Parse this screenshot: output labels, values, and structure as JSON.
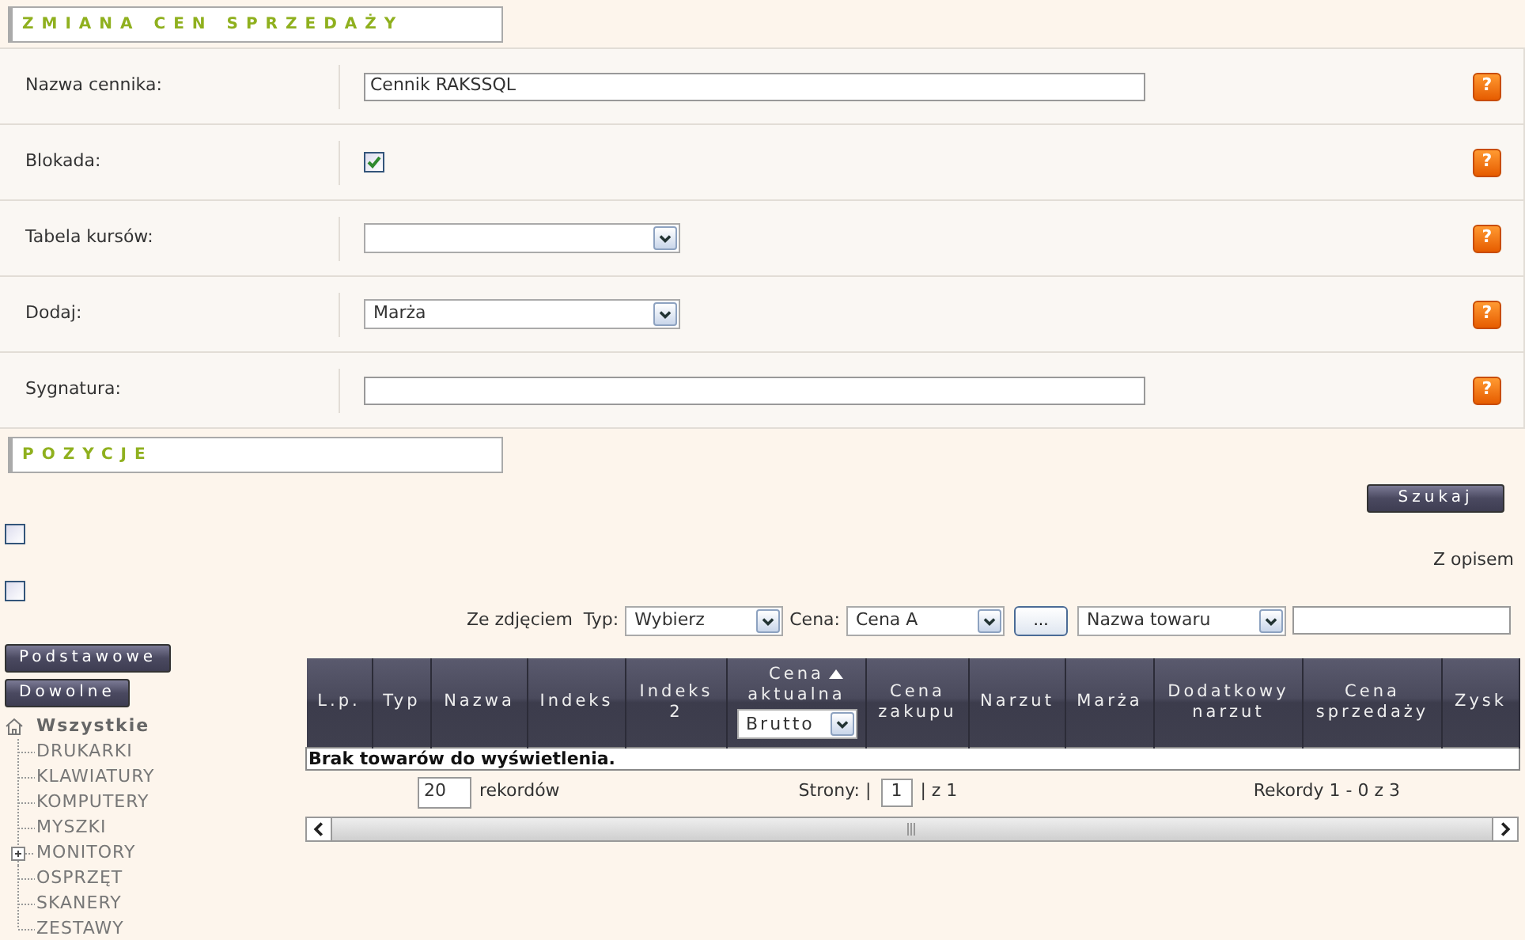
{
  "title": "ZMIANA CEN SPRZEDAŻY",
  "form": [
    {
      "kind": "text",
      "label": "Nazwa cennika:",
      "value": "Cennik RAKSSQL",
      "help": "?"
    },
    {
      "kind": "checkbox",
      "label": "Blokada:",
      "checked": true,
      "help": "?"
    },
    {
      "kind": "select",
      "label": "Tabela kursów:",
      "help": "?"
    },
    {
      "kind": "select",
      "label": "Dodaj:",
      "value": "Marża",
      "help": "?"
    },
    {
      "kind": "text",
      "label": "Sygnatura:",
      "help": "?"
    }
  ],
  "positions_title": "POZYCJE",
  "search_button": "Szukaj",
  "checkbox_1": {
    "checked": false
  },
  "description_label": "Z opisem",
  "checkbox_2": {
    "checked": false
  },
  "filters": {
    "photo_label": "Ze zdjęciem",
    "type_label": "Typ:",
    "type_value": "Wybierz",
    "price_label": "Cena:",
    "price_value": "Cena A",
    "more_button": "...",
    "field_value": "Nazwa towaru"
  },
  "sidebar_buttons": [
    "Podstawowe",
    "Dowolne"
  ],
  "tree": {
    "label": "Wszystkie",
    "children": [
      {
        "label": "DRUKARKI",
        "expandable": false
      },
      {
        "label": "KLAWIATURY",
        "expandable": false
      },
      {
        "label": "KOMPUTERY",
        "expandable": false
      },
      {
        "label": "MYSZKI",
        "expandable": false
      },
      {
        "label": "MONITORY",
        "expandable": true
      },
      {
        "label": "OSPRZĘT",
        "expandable": false
      },
      {
        "label": "SKANERY",
        "expandable": false
      },
      {
        "label": "ZESTAWY",
        "expandable": false
      }
    ]
  },
  "table": {
    "columns": [
      {
        "lines": [
          "L.p."
        ],
        "sorted": false
      },
      {
        "lines": [
          "Typ"
        ],
        "sorted": false
      },
      {
        "lines": [
          "Nazwa"
        ],
        "sorted": false
      },
      {
        "lines": [
          "Indeks"
        ],
        "sorted": false
      },
      {
        "lines": [
          "Indeks",
          "2"
        ],
        "sorted": false
      },
      {
        "lines": [
          "Cena",
          "aktualna"
        ],
        "sorted": true,
        "select": "Brutto"
      },
      {
        "lines": [
          "Cena",
          "zakupu"
        ],
        "sorted": false
      },
      {
        "lines": [
          "Narzut"
        ],
        "sorted": false
      },
      {
        "lines": [
          "Marża"
        ],
        "sorted": false
      },
      {
        "lines": [
          "Dodatkowy",
          "narzut"
        ],
        "sorted": false
      },
      {
        "lines": [
          "Cena",
          "sprzedaży"
        ],
        "sorted": false
      },
      {
        "lines": [
          "Zysk"
        ],
        "sorted": false
      }
    ],
    "empty_message": "Brak towarów do wyświetlenia."
  },
  "pager": {
    "page_size": "20",
    "page_size_label": "rekordów",
    "pages_label": "Strony: |",
    "page": "1",
    "page_total": "| z 1",
    "records": "Rekordy 1 - 0 z 3"
  }
}
